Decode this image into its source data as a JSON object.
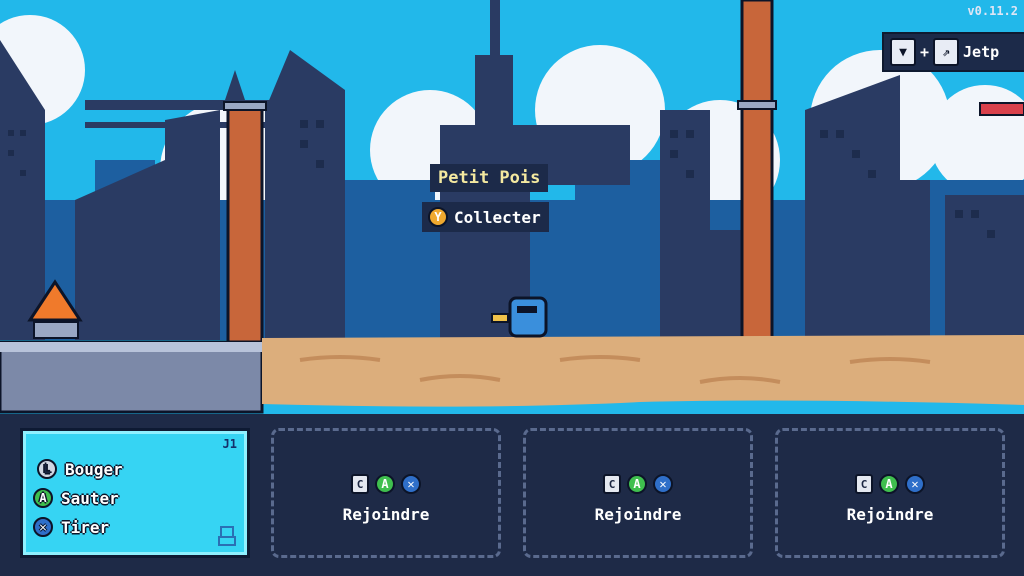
{
  "version": "v0.11.2",
  "combo_hint": {
    "label": "Jetp"
  },
  "tooltip": {
    "item_name": "Petit Pois",
    "button": "Y",
    "action": "Collecter"
  },
  "player1": {
    "tag": "J1",
    "controls": [
      {
        "button": "L",
        "label": "Bouger"
      },
      {
        "button": "A",
        "label": "Sauter"
      },
      {
        "button": "X",
        "label": "Tirer"
      }
    ]
  },
  "join_slots": [
    {
      "keys": [
        "C",
        "A",
        "X"
      ],
      "label": "Rejoindre"
    },
    {
      "keys": [
        "C",
        "A",
        "X"
      ],
      "label": "Rejoindre"
    },
    {
      "keys": [
        "C",
        "A",
        "X"
      ],
      "label": "Rejoindre"
    }
  ],
  "colors": {
    "sky": "#22b8ea",
    "city_dark": "#2a3b63",
    "city_blue": "#1d5fa0",
    "brick": "#c8663a",
    "sand": "#dcae7c",
    "hud_bg": "#1e2a47",
    "p1_panel": "#36d4f3"
  }
}
